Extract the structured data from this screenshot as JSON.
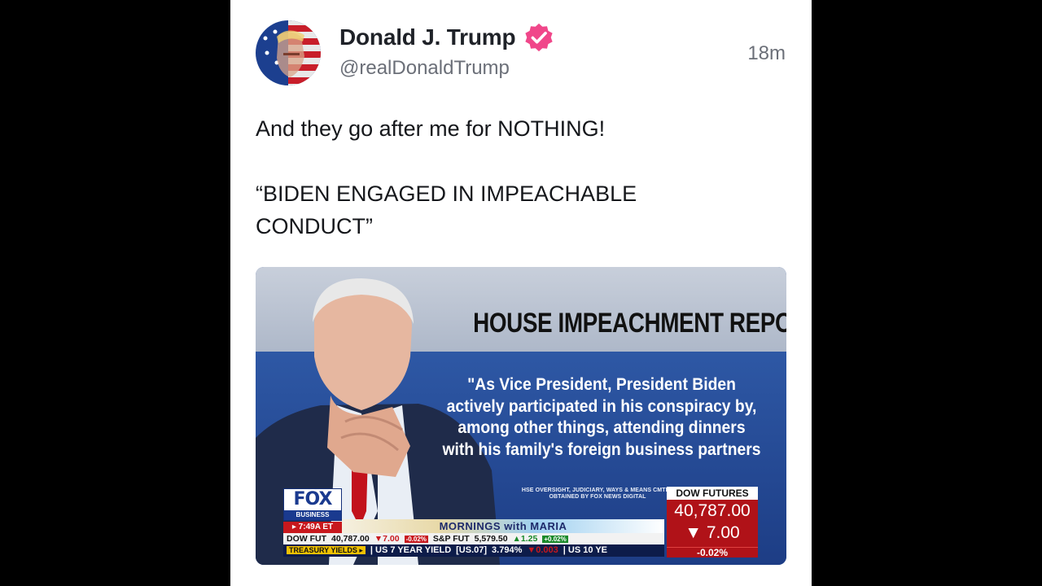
{
  "post": {
    "author_name": "Donald J. Trump",
    "handle": "@realDonaldTrump",
    "timestamp": "18m",
    "text_line1": "And they go after me for NOTHING!",
    "text_line2": "“BIDEN ENGAGED IN IMPEACHABLE",
    "text_line3": "CONDUCT”"
  },
  "media": {
    "headline": "HOUSE IMPEACHMENT REPORT",
    "quote_lines": [
      "\"As Vice President, President Biden",
      "actively participated in his conspiracy by,",
      "among other things, attending dinners",
      "with his family's foreign business partners"
    ],
    "source_line1": "HSE OVERSIGHT, JUDICIARY, WAYS & MEANS CMTES",
    "source_line2": "OBTAINED BY FOX NEWS DIGITAL",
    "network_logo": "FOX",
    "network_sub": "BUSINESS",
    "broadcast_time": "▸ 7:49A ET",
    "show_name": "MORNINGS with MARIA",
    "ticker1": {
      "dow_label": "DOW FUT",
      "dow_value": "40,787.00",
      "dow_change": "▼7.00",
      "dow_pct": "-0.02%",
      "sp_label": "S&P FUT",
      "sp_value": "5,579.50",
      "sp_change": "▲1.25",
      "sp_pct": "+0.02%"
    },
    "ticker2": {
      "label": "TREASURY YIELDS ▸",
      "item1": "| US 7 YEAR YIELD",
      "item1_code": "[US.07]",
      "item1_value": "3.794%",
      "item1_change": "▼0.003",
      "item2": "| US 10 YE"
    },
    "dow_box": {
      "title": "DOW FUTURES",
      "value": "40,787.00",
      "change": "▼  7.00",
      "pct": "-0.02%"
    }
  },
  "colors": {
    "verified_badge": "#f0478a",
    "fox_blue": "#1a3a8f",
    "fox_red": "#c8181d"
  },
  "icons": {
    "verified": "verified-badge-icon"
  }
}
